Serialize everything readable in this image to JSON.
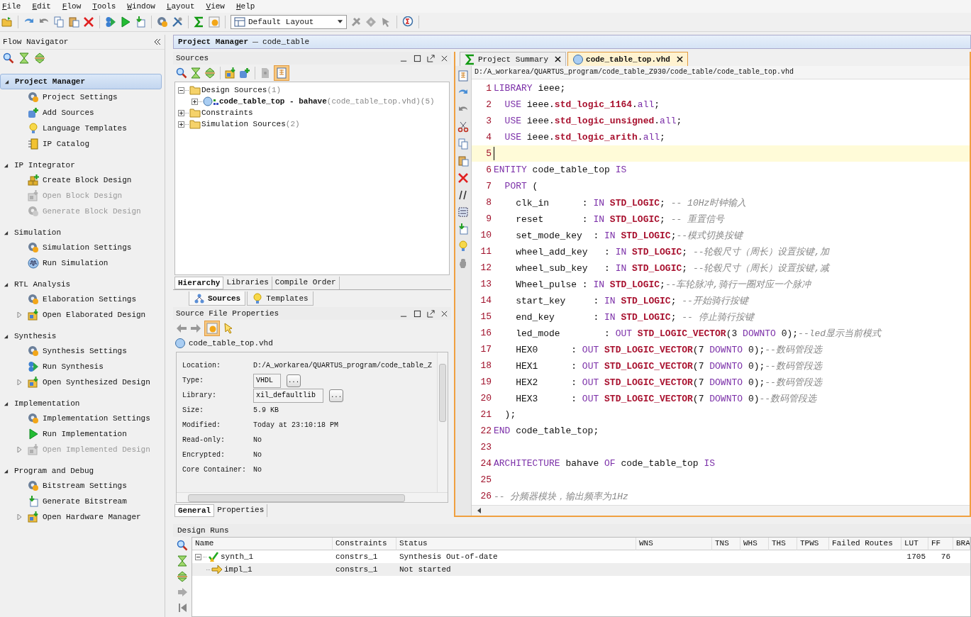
{
  "menu": [
    "File",
    "Edit",
    "Flow",
    "Tools",
    "Window",
    "Layout",
    "View",
    "Help"
  ],
  "toolbar": {
    "layout": "Default Layout"
  },
  "flow_navigator": {
    "title": "Flow Navigator",
    "sections": [
      {
        "label": "Project Manager",
        "expanded": true,
        "selected": true,
        "items": [
          {
            "label": "Project Settings",
            "disabled": false,
            "expandable": false
          },
          {
            "label": "Add Sources",
            "disabled": false,
            "expandable": false
          },
          {
            "label": "Language Templates",
            "disabled": false,
            "expandable": false
          },
          {
            "label": "IP Catalog",
            "disabled": false,
            "expandable": false
          }
        ]
      },
      {
        "label": "IP Integrator",
        "expanded": true,
        "selected": false,
        "items": [
          {
            "label": "Create Block Design",
            "disabled": false,
            "expandable": false
          },
          {
            "label": "Open Block Design",
            "disabled": true,
            "expandable": false
          },
          {
            "label": "Generate Block Design",
            "disabled": true,
            "expandable": false
          }
        ]
      },
      {
        "label": "Simulation",
        "expanded": true,
        "selected": false,
        "items": [
          {
            "label": "Simulation Settings",
            "disabled": false,
            "expandable": false
          },
          {
            "label": "Run Simulation",
            "disabled": false,
            "expandable": false
          }
        ]
      },
      {
        "label": "RTL Analysis",
        "expanded": true,
        "selected": false,
        "items": [
          {
            "label": "Elaboration Settings",
            "disabled": false,
            "expandable": false
          },
          {
            "label": "Open Elaborated Design",
            "disabled": false,
            "expandable": true
          }
        ]
      },
      {
        "label": "Synthesis",
        "expanded": true,
        "selected": false,
        "items": [
          {
            "label": "Synthesis Settings",
            "disabled": false,
            "expandable": false
          },
          {
            "label": "Run Synthesis",
            "disabled": false,
            "expandable": false
          },
          {
            "label": "Open Synthesized Design",
            "disabled": false,
            "expandable": true
          }
        ]
      },
      {
        "label": "Implementation",
        "expanded": true,
        "selected": false,
        "items": [
          {
            "label": "Implementation Settings",
            "disabled": false,
            "expandable": false
          },
          {
            "label": "Run Implementation",
            "disabled": false,
            "expandable": false
          },
          {
            "label": "Open Implemented Design",
            "disabled": true,
            "expandable": true
          }
        ]
      },
      {
        "label": "Program and Debug",
        "expanded": true,
        "selected": false,
        "items": [
          {
            "label": "Bitstream Settings",
            "disabled": false,
            "expandable": false
          },
          {
            "label": "Generate Bitstream",
            "disabled": false,
            "expandable": false
          },
          {
            "label": "Open Hardware Manager",
            "disabled": false,
            "expandable": true
          }
        ]
      }
    ]
  },
  "project_manager": {
    "title": "Project Manager",
    "subtitle": "code_table"
  },
  "sources": {
    "title": "Sources",
    "tree": [
      {
        "kind": "folder",
        "label": "Design Sources",
        "count": "(1)",
        "expanded": true,
        "children": [
          {
            "kind": "module",
            "label": "code_table_top - bahave",
            "file": "(code_table_top.vhd)",
            "count": "(5)",
            "expanded": false
          }
        ]
      },
      {
        "kind": "folder",
        "label": "Constraints",
        "expanded": false
      },
      {
        "kind": "folder",
        "label": "Simulation Sources",
        "count": "(2)",
        "expanded": false
      }
    ],
    "tabs": [
      {
        "label": "Hierarchy",
        "selected": true
      },
      {
        "label": "Libraries",
        "selected": false
      },
      {
        "label": "Compile Order",
        "selected": false
      }
    ],
    "bottom_tabs": [
      {
        "label": "Sources",
        "selected": true
      },
      {
        "label": "Templates",
        "selected": false
      }
    ]
  },
  "properties": {
    "title": "Source File Properties",
    "file": "code_table_top.vhd",
    "rows": [
      {
        "kind": "text",
        "label": "Location:",
        "value": "D:/A_workarea/QUARTUS_program/code_table_Z"
      },
      {
        "kind": "field",
        "label": "Type:",
        "value": "VHDL",
        "button": "..."
      },
      {
        "kind": "field",
        "label": "Library:",
        "value": "xil_defaultlib",
        "button": "..."
      },
      {
        "kind": "text",
        "label": "Size:",
        "value": "5.9 KB"
      },
      {
        "kind": "text",
        "label": "Modified:",
        "value": "Today at 23:10:18 PM"
      },
      {
        "kind": "text",
        "label": "Read-only:",
        "value": "No"
      },
      {
        "kind": "text",
        "label": "Encrypted:",
        "value": "No"
      },
      {
        "kind": "text",
        "label": "Core Container:",
        "value": "No"
      }
    ],
    "tabs": [
      {
        "label": "General",
        "selected": true
      },
      {
        "label": "Properties",
        "selected": false
      }
    ]
  },
  "editor": {
    "tabs": [
      {
        "kind": "summary",
        "label": "Project Summary",
        "selected": false
      },
      {
        "kind": "vhdl",
        "label": "code_table_top.vhd",
        "selected": true
      }
    ],
    "path": "D:/A_workarea/QUARTUS_program/code_table_Z930/code_table/code_table_top.vhd",
    "lines": [
      {
        "n": "1",
        "current": false,
        "t": [
          {
            "kw": "LIBRARY"
          },
          {
            "id": " ieee;"
          }
        ]
      },
      {
        "n": "2",
        "current": false,
        "t": [
          {
            "kw": "  USE"
          },
          {
            "id": " ieee."
          },
          {
            "type": "std_logic_1164"
          },
          {
            "id": "."
          },
          {
            "kw": "all"
          },
          {
            "id": ";"
          }
        ]
      },
      {
        "n": "3",
        "current": false,
        "t": [
          {
            "kw": "  USE"
          },
          {
            "id": " ieee."
          },
          {
            "type": "std_logic_unsigned"
          },
          {
            "id": "."
          },
          {
            "kw": "all"
          },
          {
            "id": ";"
          }
        ]
      },
      {
        "n": "4",
        "current": false,
        "t": [
          {
            "kw": "  USE"
          },
          {
            "id": " ieee."
          },
          {
            "type": "std_logic_arith"
          },
          {
            "id": "."
          },
          {
            "kw": "all"
          },
          {
            "id": ";"
          }
        ]
      },
      {
        "n": "5",
        "current": true
      },
      {
        "n": "6",
        "current": false,
        "t": [
          {
            "kw": "ENTITY"
          },
          {
            "id": " code_table_top "
          },
          {
            "kw": "IS"
          }
        ]
      },
      {
        "n": "7",
        "current": false,
        "t": [
          {
            "kw": "  PORT"
          },
          {
            "id": " ("
          }
        ]
      },
      {
        "n": "8",
        "current": false,
        "t": [
          {
            "id": "    clk_in      : "
          },
          {
            "kw": "IN"
          },
          {
            "type": " STD_LOGIC"
          },
          {
            "id": "; "
          },
          {
            "cm": "-- 10Hz时钟输入"
          }
        ]
      },
      {
        "n": "9",
        "current": false,
        "t": [
          {
            "id": "    reset       : "
          },
          {
            "kw": "IN"
          },
          {
            "type": " STD_LOGIC"
          },
          {
            "id": "; "
          },
          {
            "cm": "-- 重置信号"
          }
        ]
      },
      {
        "n": "10",
        "current": false,
        "t": [
          {
            "id": "    set_mode_key  : "
          },
          {
            "kw": "IN"
          },
          {
            "type": " STD_LOGIC"
          },
          {
            "id": ";"
          },
          {
            "cm": "--模式切换按键"
          }
        ]
      },
      {
        "n": "11",
        "current": false,
        "t": [
          {
            "id": "    wheel_add_key   : "
          },
          {
            "kw": "IN"
          },
          {
            "type": " STD_LOGIC"
          },
          {
            "id": "; "
          },
          {
            "cm": "--轮毂尺寸（周长）设置按键,加"
          }
        ]
      },
      {
        "n": "12",
        "current": false,
        "t": [
          {
            "id": "    wheel_sub_key   : "
          },
          {
            "kw": "IN"
          },
          {
            "type": " STD_LOGIC"
          },
          {
            "id": "; "
          },
          {
            "cm": "--轮毂尺寸（周长）设置按键,减"
          }
        ]
      },
      {
        "n": "13",
        "current": false,
        "t": [
          {
            "id": "    Wheel_pulse : "
          },
          {
            "kw": "IN"
          },
          {
            "type": " STD_LOGIC"
          },
          {
            "id": ";"
          },
          {
            "cm": "--车轮脉冲,骑行一圈对应一个脉冲"
          }
        ]
      },
      {
        "n": "14",
        "current": false,
        "t": [
          {
            "id": "    start_key     : "
          },
          {
            "kw": "IN"
          },
          {
            "type": " STD_LOGIC"
          },
          {
            "id": "; "
          },
          {
            "cm": "--开始骑行按键"
          }
        ]
      },
      {
        "n": "15",
        "current": false,
        "t": [
          {
            "id": "    end_key       : "
          },
          {
            "kw": "IN"
          },
          {
            "type": " STD_LOGIC"
          },
          {
            "id": "; "
          },
          {
            "cm": "-- 停止骑行按键"
          }
        ]
      },
      {
        "n": "16",
        "current": false,
        "t": [
          {
            "id": "    led_mode        : "
          },
          {
            "kw": "OUT"
          },
          {
            "type": " STD_LOGIC_VECTOR"
          },
          {
            "id": "(3 "
          },
          {
            "kw": "DOWNTO"
          },
          {
            "id": " 0);"
          },
          {
            "cm": "--led显示当前模式"
          }
        ]
      },
      {
        "n": "17",
        "current": false,
        "t": [
          {
            "id": "    HEX0      : "
          },
          {
            "kw": "OUT"
          },
          {
            "type": " STD_LOGIC_VECTOR"
          },
          {
            "id": "(7 "
          },
          {
            "kw": "DOWNTO"
          },
          {
            "id": " 0);"
          },
          {
            "cm": "--数码管段选"
          }
        ]
      },
      {
        "n": "18",
        "current": false,
        "t": [
          {
            "id": "    HEX1      : "
          },
          {
            "kw": "OUT"
          },
          {
            "type": " STD_LOGIC_VECTOR"
          },
          {
            "id": "(7 "
          },
          {
            "kw": "DOWNTO"
          },
          {
            "id": " 0);"
          },
          {
            "cm": "--数码管段选"
          }
        ]
      },
      {
        "n": "19",
        "current": false,
        "t": [
          {
            "id": "    HEX2      : "
          },
          {
            "kw": "OUT"
          },
          {
            "type": " STD_LOGIC_VECTOR"
          },
          {
            "id": "(7 "
          },
          {
            "kw": "DOWNTO"
          },
          {
            "id": " 0);"
          },
          {
            "cm": "--数码管段选"
          }
        ]
      },
      {
        "n": "20",
        "current": false,
        "t": [
          {
            "id": "    HEX3      : "
          },
          {
            "kw": "OUT"
          },
          {
            "type": " STD_LOGIC_VECTOR"
          },
          {
            "id": "(7 "
          },
          {
            "kw": "DOWNTO"
          },
          {
            "id": " 0)"
          },
          {
            "cm": "--数码管段选"
          }
        ]
      },
      {
        "n": "21",
        "current": false,
        "t": [
          {
            "id": "  );"
          }
        ]
      },
      {
        "n": "22",
        "current": false,
        "t": [
          {
            "kw": "END"
          },
          {
            "id": " code_table_top;"
          }
        ]
      },
      {
        "n": "23",
        "current": false
      },
      {
        "n": "24",
        "current": false,
        "t": [
          {
            "kw": "ARCHITECTURE"
          },
          {
            "id": " bahave "
          },
          {
            "kw": "OF"
          },
          {
            "id": " code_table_top "
          },
          {
            "kw": "IS"
          }
        ]
      },
      {
        "n": "25",
        "current": false
      },
      {
        "n": "26",
        "current": false,
        "t": [
          {
            "cm": "-- 分频器模块，输出频率为1Hz"
          }
        ]
      }
    ]
  },
  "design_runs": {
    "title": "Design Runs",
    "columns": [
      "Name",
      "Constraints",
      "Status",
      "WNS",
      "TNS",
      "WHS",
      "THS",
      "TPWS",
      "Failed Routes",
      "LUT",
      "FF",
      "BRA"
    ],
    "rows": [
      {
        "kind": "synth",
        "name": "synth_1",
        "constraints": "constrs_1",
        "status": "Synthesis Out-of-date",
        "lut": "1705",
        "ff": "76",
        "expanded": true,
        "children": [
          {
            "kind": "impl",
            "name": "impl_1",
            "constraints": "constrs_1",
            "status": "Not started"
          }
        ]
      }
    ]
  }
}
